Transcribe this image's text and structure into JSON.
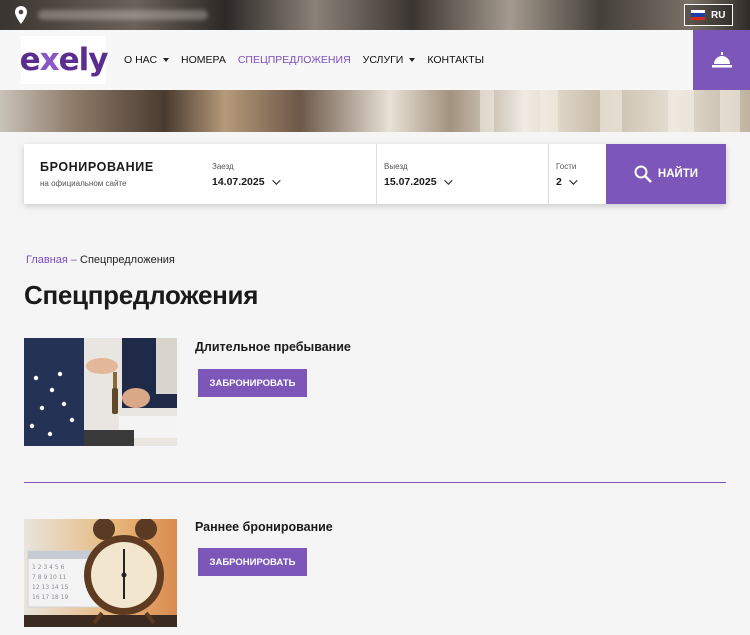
{
  "topbar": {
    "language": "RU"
  },
  "header": {
    "logo": "exely",
    "nav": [
      {
        "label": "О НАС",
        "dropdown": true
      },
      {
        "label": "НОМЕРА",
        "dropdown": false
      },
      {
        "label": "СПЕЦПРЕДЛОЖЕНИЯ",
        "dropdown": false,
        "active": true
      },
      {
        "label": "УСЛУГИ",
        "dropdown": true
      },
      {
        "label": "КОНТАКТЫ",
        "dropdown": false
      }
    ]
  },
  "booking": {
    "title": "БРОНИРОВАНИЕ",
    "subtitle": "на официальном сайте",
    "checkin_label": "Заезд",
    "checkin_value": "14.07.2025",
    "checkout_label": "Выезд",
    "checkout_value": "15.07.2025",
    "guests_label": "Гости",
    "guests_value": "2",
    "search_label": "НАЙТИ"
  },
  "breadcrumb": {
    "home": "Главная",
    "separator": "–",
    "current": "Спецпредложения"
  },
  "page_title": "Спецпредложения",
  "offers": [
    {
      "title": "Длительное пребывание",
      "button": "ЗАБРОНИРОВАТЬ",
      "image": "keys-handover-photo"
    },
    {
      "title": "Раннее бронирование",
      "button": "ЗАБРОНИРОВАТЬ",
      "image": "alarm-clock-calendar-photo"
    }
  ],
  "colors": {
    "accent": "#7c56b8",
    "logo": "#5b2d8e",
    "background": "#f5f5f5"
  }
}
